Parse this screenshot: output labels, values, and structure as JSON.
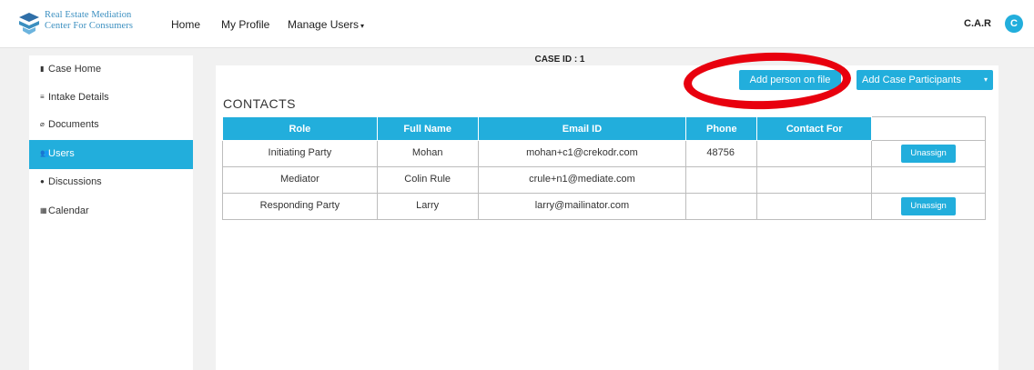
{
  "brand": {
    "line1": "Real Estate Mediation",
    "line2": "Center For Consumers"
  },
  "nav": {
    "home": "Home",
    "profile": "My Profile",
    "manage_users": "Manage Users",
    "caret": "▾"
  },
  "user": {
    "org": "C.A.R",
    "avatar_initial": "C"
  },
  "sidebar": {
    "items": [
      {
        "label": "Case Home",
        "icon": "▮"
      },
      {
        "label": "Intake Details",
        "icon": "≡"
      },
      {
        "label": "Documents",
        "icon": "⌀"
      },
      {
        "label": "Users",
        "icon": "👥"
      },
      {
        "label": "Discussions",
        "icon": "●"
      },
      {
        "label": "Calendar",
        "icon": "▦"
      }
    ]
  },
  "case": {
    "id_text": "CASE ID : 1"
  },
  "buttons": {
    "add_person": "Add person on file",
    "add_participants": "Add Case Participants",
    "dropdown_caret": "▾"
  },
  "contacts": {
    "title": "CONTACTS",
    "headers": [
      "Role",
      "Full Name",
      "Email ID",
      "Phone",
      "Contact For",
      ""
    ],
    "rows": [
      {
        "role": "Initiating Party",
        "name": "Mohan",
        "email": "mohan+c1@crekodr.com",
        "phone": "48756",
        "contact_for": "",
        "action": "Unassign"
      },
      {
        "role": "Mediator",
        "name": "Colin Rule",
        "email": "crule+n1@mediate.com",
        "phone": "",
        "contact_for": "",
        "action": ""
      },
      {
        "role": "Responding Party",
        "name": "Larry",
        "email": "larry@mailinator.com",
        "phone": "",
        "contact_for": "",
        "action": "Unassign"
      }
    ]
  },
  "colors": {
    "accent": "#22aedc",
    "annotation": "#e8000e",
    "brand": "#3b8fc0"
  }
}
